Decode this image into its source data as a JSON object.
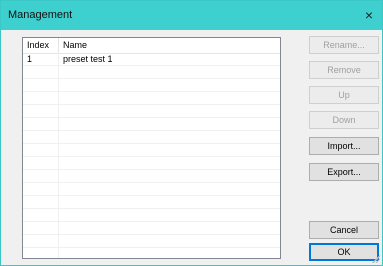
{
  "window": {
    "title": "Management",
    "close_symbol": "×",
    "accent_color": "#3ed0cf"
  },
  "list": {
    "columns": [
      "Index",
      "Name"
    ],
    "rows": [
      {
        "index": "1",
        "name": "preset test 1"
      }
    ]
  },
  "buttons": {
    "rename": "Rename...",
    "remove": "Remove",
    "up": "Up",
    "down": "Down",
    "import": "Import...",
    "export": "Export...",
    "cancel": "Cancel",
    "ok": "OK"
  }
}
